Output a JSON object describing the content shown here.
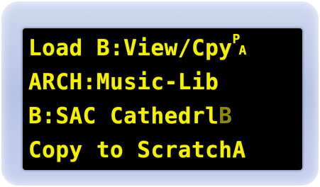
{
  "display": {
    "line1": {
      "text": "Load B:View/Cpy",
      "glyph_top": "P",
      "glyph_bottom": "A"
    },
    "line2": {
      "text": "ARCH:Music-Lib"
    },
    "line3": {
      "text": "B:SAC Cathedrl",
      "status_char": "B"
    },
    "line4": {
      "text": "Copy to ScratchA"
    }
  },
  "colors": {
    "bezel": "#c4cdea",
    "screen_bg": "#000000",
    "text": "#f4f100",
    "dim_text": "#8c8a10"
  }
}
